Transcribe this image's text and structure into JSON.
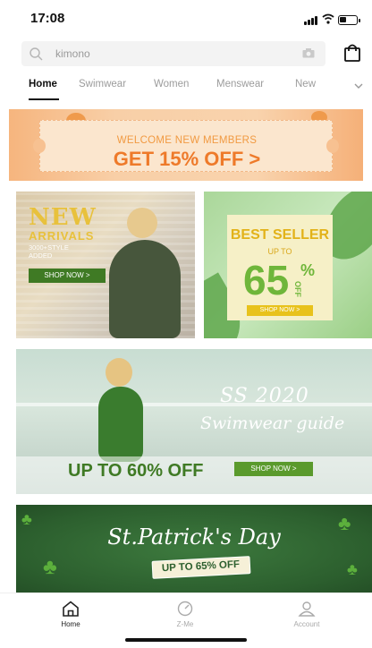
{
  "status": {
    "time": "17:08"
  },
  "search": {
    "query": "kimono"
  },
  "tabs": [
    "Home",
    "Swimwear",
    "Women",
    "Menswear",
    "New"
  ],
  "banner": {
    "line1": "WELCOME NEW MEMBERS",
    "line2": "GET 15% OFF >"
  },
  "new_arrivals": {
    "title": "NEW",
    "subtitle": "ARRIVALS",
    "small": "3000+STYLE ADDED",
    "button": "SHOP NOW >"
  },
  "best_seller": {
    "title": "BEST SELLER",
    "up_to": "UP TO",
    "number": "65",
    "percent": "%",
    "off": "OFF",
    "button": "SHOP NOW >"
  },
  "swimwear": {
    "season": "SS 2020",
    "guide": "Swimwear guide",
    "offer": "UP TO 60% OFF",
    "button": "SHOP NOW >"
  },
  "patricks": {
    "title": "St.Patrick's Day",
    "offer": "UP TO 65% OFF"
  },
  "bottom_nav": [
    {
      "label": "Home",
      "icon": "home-icon"
    },
    {
      "label": "Z-Me",
      "icon": "gauge-icon"
    },
    {
      "label": "Account",
      "icon": "user-icon"
    }
  ],
  "colors": {
    "accent_orange": "#ee7a2a",
    "accent_green": "#3f7a24",
    "accent_yellow": "#e2b219"
  }
}
